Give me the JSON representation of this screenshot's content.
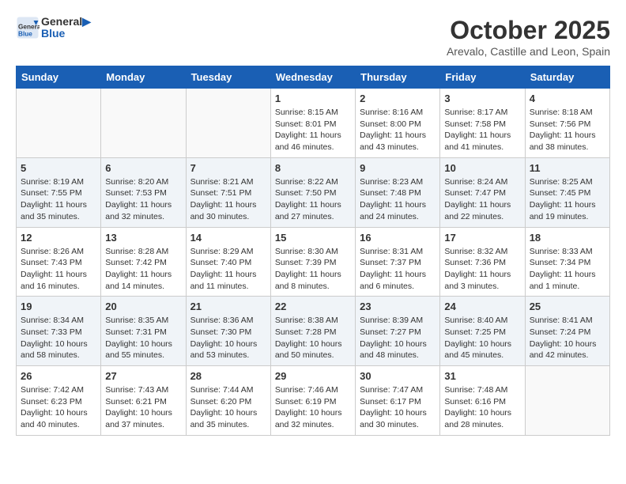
{
  "logo": {
    "line1": "General",
    "line2": "Blue"
  },
  "title": "October 2025",
  "subtitle": "Arevalo, Castille and Leon, Spain",
  "weekdays": [
    "Sunday",
    "Monday",
    "Tuesday",
    "Wednesday",
    "Thursday",
    "Friday",
    "Saturday"
  ],
  "weeks": [
    [
      {
        "day": "",
        "info": ""
      },
      {
        "day": "",
        "info": ""
      },
      {
        "day": "",
        "info": ""
      },
      {
        "day": "1",
        "info": "Sunrise: 8:15 AM\nSunset: 8:01 PM\nDaylight: 11 hours\nand 46 minutes."
      },
      {
        "day": "2",
        "info": "Sunrise: 8:16 AM\nSunset: 8:00 PM\nDaylight: 11 hours\nand 43 minutes."
      },
      {
        "day": "3",
        "info": "Sunrise: 8:17 AM\nSunset: 7:58 PM\nDaylight: 11 hours\nand 41 minutes."
      },
      {
        "day": "4",
        "info": "Sunrise: 8:18 AM\nSunset: 7:56 PM\nDaylight: 11 hours\nand 38 minutes."
      }
    ],
    [
      {
        "day": "5",
        "info": "Sunrise: 8:19 AM\nSunset: 7:55 PM\nDaylight: 11 hours\nand 35 minutes."
      },
      {
        "day": "6",
        "info": "Sunrise: 8:20 AM\nSunset: 7:53 PM\nDaylight: 11 hours\nand 32 minutes."
      },
      {
        "day": "7",
        "info": "Sunrise: 8:21 AM\nSunset: 7:51 PM\nDaylight: 11 hours\nand 30 minutes."
      },
      {
        "day": "8",
        "info": "Sunrise: 8:22 AM\nSunset: 7:50 PM\nDaylight: 11 hours\nand 27 minutes."
      },
      {
        "day": "9",
        "info": "Sunrise: 8:23 AM\nSunset: 7:48 PM\nDaylight: 11 hours\nand 24 minutes."
      },
      {
        "day": "10",
        "info": "Sunrise: 8:24 AM\nSunset: 7:47 PM\nDaylight: 11 hours\nand 22 minutes."
      },
      {
        "day": "11",
        "info": "Sunrise: 8:25 AM\nSunset: 7:45 PM\nDaylight: 11 hours\nand 19 minutes."
      }
    ],
    [
      {
        "day": "12",
        "info": "Sunrise: 8:26 AM\nSunset: 7:43 PM\nDaylight: 11 hours\nand 16 minutes."
      },
      {
        "day": "13",
        "info": "Sunrise: 8:28 AM\nSunset: 7:42 PM\nDaylight: 11 hours\nand 14 minutes."
      },
      {
        "day": "14",
        "info": "Sunrise: 8:29 AM\nSunset: 7:40 PM\nDaylight: 11 hours\nand 11 minutes."
      },
      {
        "day": "15",
        "info": "Sunrise: 8:30 AM\nSunset: 7:39 PM\nDaylight: 11 hours\nand 8 minutes."
      },
      {
        "day": "16",
        "info": "Sunrise: 8:31 AM\nSunset: 7:37 PM\nDaylight: 11 hours\nand 6 minutes."
      },
      {
        "day": "17",
        "info": "Sunrise: 8:32 AM\nSunset: 7:36 PM\nDaylight: 11 hours\nand 3 minutes."
      },
      {
        "day": "18",
        "info": "Sunrise: 8:33 AM\nSunset: 7:34 PM\nDaylight: 11 hours\nand 1 minute."
      }
    ],
    [
      {
        "day": "19",
        "info": "Sunrise: 8:34 AM\nSunset: 7:33 PM\nDaylight: 10 hours\nand 58 minutes."
      },
      {
        "day": "20",
        "info": "Sunrise: 8:35 AM\nSunset: 7:31 PM\nDaylight: 10 hours\nand 55 minutes."
      },
      {
        "day": "21",
        "info": "Sunrise: 8:36 AM\nSunset: 7:30 PM\nDaylight: 10 hours\nand 53 minutes."
      },
      {
        "day": "22",
        "info": "Sunrise: 8:38 AM\nSunset: 7:28 PM\nDaylight: 10 hours\nand 50 minutes."
      },
      {
        "day": "23",
        "info": "Sunrise: 8:39 AM\nSunset: 7:27 PM\nDaylight: 10 hours\nand 48 minutes."
      },
      {
        "day": "24",
        "info": "Sunrise: 8:40 AM\nSunset: 7:25 PM\nDaylight: 10 hours\nand 45 minutes."
      },
      {
        "day": "25",
        "info": "Sunrise: 8:41 AM\nSunset: 7:24 PM\nDaylight: 10 hours\nand 42 minutes."
      }
    ],
    [
      {
        "day": "26",
        "info": "Sunrise: 7:42 AM\nSunset: 6:23 PM\nDaylight: 10 hours\nand 40 minutes."
      },
      {
        "day": "27",
        "info": "Sunrise: 7:43 AM\nSunset: 6:21 PM\nDaylight: 10 hours\nand 37 minutes."
      },
      {
        "day": "28",
        "info": "Sunrise: 7:44 AM\nSunset: 6:20 PM\nDaylight: 10 hours\nand 35 minutes."
      },
      {
        "day": "29",
        "info": "Sunrise: 7:46 AM\nSunset: 6:19 PM\nDaylight: 10 hours\nand 32 minutes."
      },
      {
        "day": "30",
        "info": "Sunrise: 7:47 AM\nSunset: 6:17 PM\nDaylight: 10 hours\nand 30 minutes."
      },
      {
        "day": "31",
        "info": "Sunrise: 7:48 AM\nSunset: 6:16 PM\nDaylight: 10 hours\nand 28 minutes."
      },
      {
        "day": "",
        "info": ""
      }
    ]
  ]
}
